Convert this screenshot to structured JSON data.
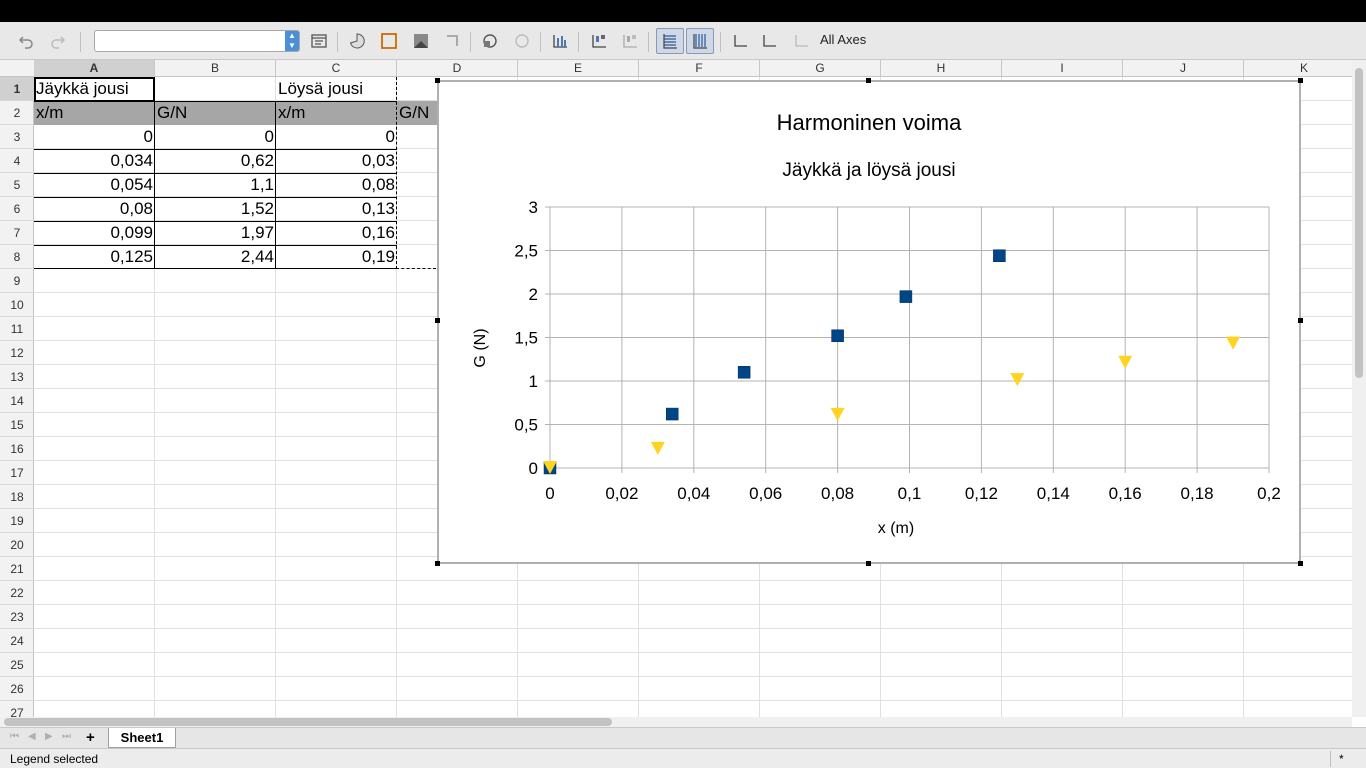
{
  "toolbar": {
    "icons": [
      "undo-icon",
      "redo-icon",
      "chart-element-select",
      "format-selection-icon",
      "chart-type-icon",
      "chart-area-icon",
      "chart-wall-icon",
      "chart-floor-icon",
      "3d-view-icon",
      "data-table-icon",
      "data-ranges-icon",
      "insert-titles-icon",
      "legend-on-off-icon",
      "legend-icon",
      "horizontal-grids-icon",
      "vertical-grids-icon",
      "x-axis-icon",
      "y-axis-icon",
      "z-axis-icon"
    ],
    "element_combo_value": "",
    "axes_label": "All Axes"
  },
  "columns": [
    "A",
    "B",
    "C",
    "D",
    "E",
    "F",
    "G",
    "H",
    "I",
    "J",
    "K"
  ],
  "rows": [
    "1",
    "2",
    "3",
    "4",
    "5",
    "6",
    "7",
    "8",
    "9",
    "10",
    "11",
    "12",
    "13",
    "14",
    "15",
    "16",
    "17",
    "18",
    "19",
    "20",
    "21",
    "22",
    "23",
    "24",
    "25",
    "26",
    "27"
  ],
  "cells": {
    "a1": "Jäykkä jousi",
    "c1": "Löysä jousi",
    "a2": "x/m",
    "b2": "G/N",
    "c2": "x/m",
    "d2": "G/N",
    "a3": "0",
    "b3": "0",
    "c3": "0",
    "a4": "0,034",
    "b4": "0,62",
    "c4": "0,03",
    "a5": "0,054",
    "b5": "1,1",
    "c5": "0,08",
    "a6": "0,08",
    "b6": "1,52",
    "c6": "0,13",
    "a7": "0,099",
    "b7": "1,97",
    "c7": "0,16",
    "a8": "0,125",
    "b8": "2,44",
    "c8": "0,19"
  },
  "chart_data": {
    "type": "scatter",
    "title": "Harmoninen voima",
    "subtitle": "Jäykkä ja löysä jousi",
    "xlabel": "x (m)",
    "ylabel": "G (N)",
    "xlim": [
      0,
      0.2
    ],
    "ylim": [
      0,
      3
    ],
    "x_ticks": [
      "0",
      "0,02",
      "0,04",
      "0,06",
      "0,08",
      "0,1",
      "0,12",
      "0,14",
      "0,16",
      "0,18",
      "0,2"
    ],
    "y_ticks": [
      "0",
      "0,5",
      "1",
      "1,5",
      "2",
      "2,5",
      "3"
    ],
    "grid": true,
    "series": [
      {
        "marker": "square",
        "color": "#004586",
        "x": [
          0,
          0.034,
          0.054,
          0.08,
          0.099,
          0.125
        ],
        "y": [
          0,
          0.62,
          1.1,
          1.52,
          1.97,
          2.44
        ]
      },
      {
        "marker": "triangle-down",
        "color": "#ffd320",
        "x": [
          0,
          0.03,
          0.08,
          0.13,
          0.16,
          0.19
        ],
        "y": [
          0,
          0.22,
          0.61,
          1.01,
          1.21,
          1.43
        ]
      }
    ]
  },
  "sheet_tabs": [
    "Sheet1"
  ],
  "add_sheet": "+",
  "status": {
    "text": "Legend selected",
    "modified": "*"
  }
}
